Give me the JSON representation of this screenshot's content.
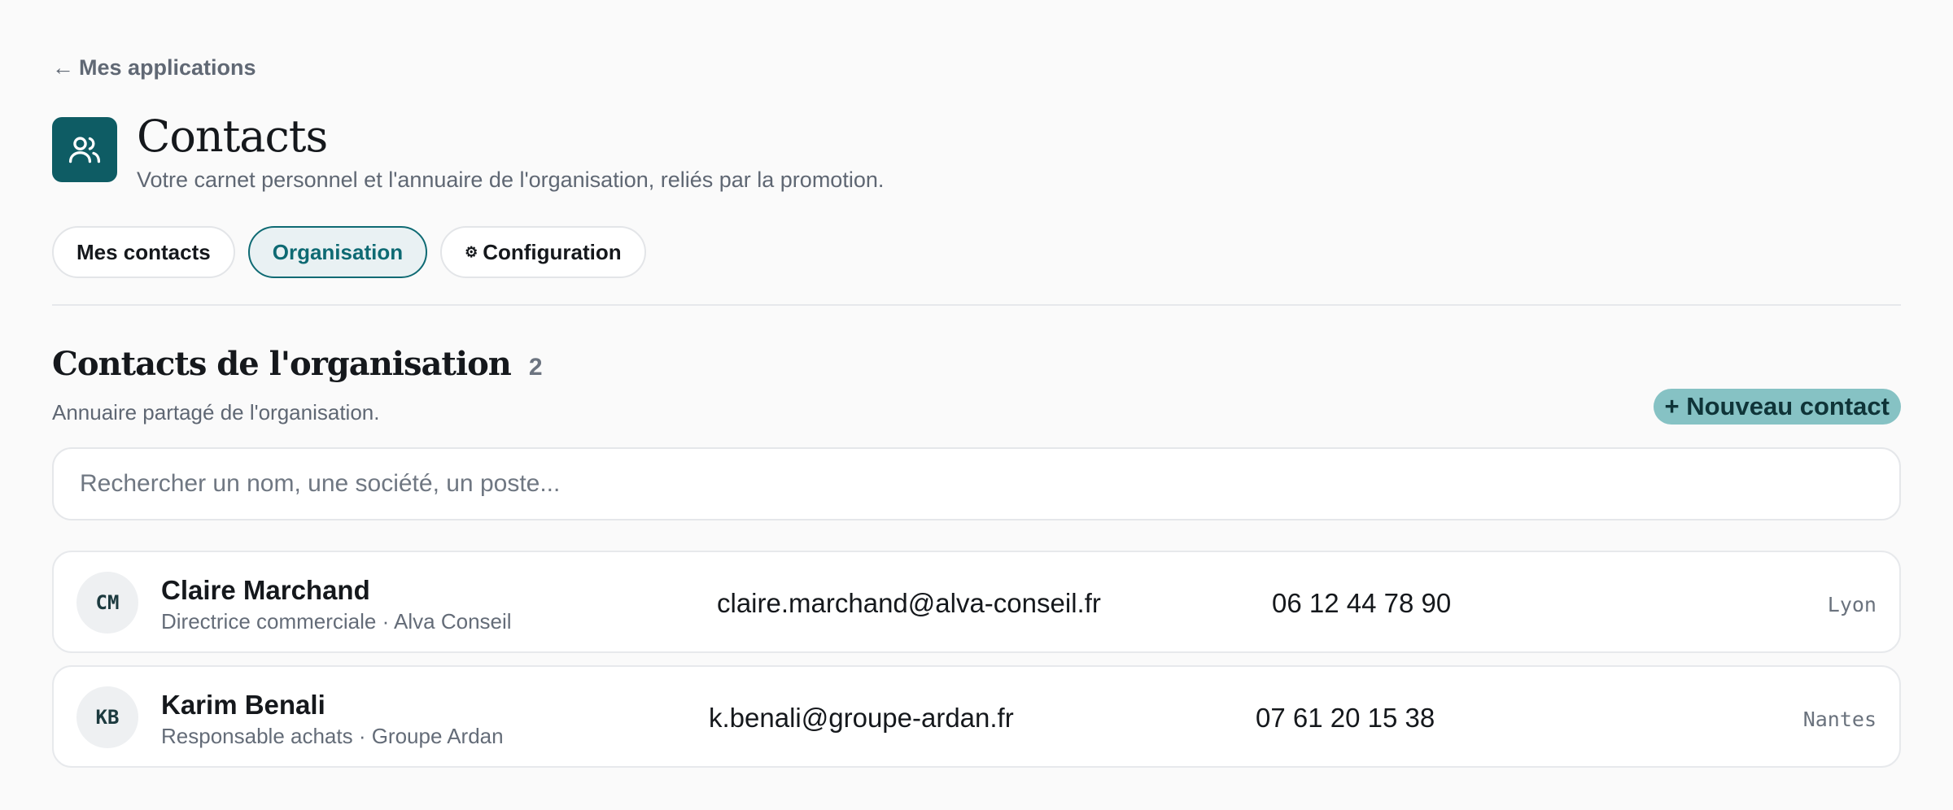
{
  "nav": {
    "back_label": "Mes applications"
  },
  "header": {
    "title": "Contacts",
    "subtitle": "Votre carnet personnel et l'annuaire de l'organisation, reliés par la promotion."
  },
  "tabs": [
    {
      "label": "Mes contacts",
      "active": false
    },
    {
      "label": "Organisation",
      "active": true
    },
    {
      "label": "Configuration",
      "active": false,
      "icon": "gear-icon"
    }
  ],
  "section": {
    "title": "Contacts de l'organisation",
    "count": "2",
    "description": "Annuaire partagé de l'organisation.",
    "new_button_label": "+ Nouveau contact"
  },
  "search": {
    "placeholder": "Rechercher un nom, une société, un poste...",
    "value": ""
  },
  "contacts": [
    {
      "initials": "CM",
      "name": "Claire Marchand",
      "role": "Directrice commerciale · Alva Conseil",
      "email": "claire.marchand@alva-conseil.fr",
      "phone": "06 12 44 78 90",
      "city": "Lyon"
    },
    {
      "initials": "KB",
      "name": "Karim Benali",
      "role": "Responsable achats · Groupe Ardan",
      "email": "k.benali@groupe-ardan.fr",
      "phone": "07 61 20 15 38",
      "city": "Nantes"
    }
  ],
  "colors": {
    "accent": "#0e5c64",
    "tab_active": "#0e6a73",
    "button_bg": "#86c2c4"
  }
}
